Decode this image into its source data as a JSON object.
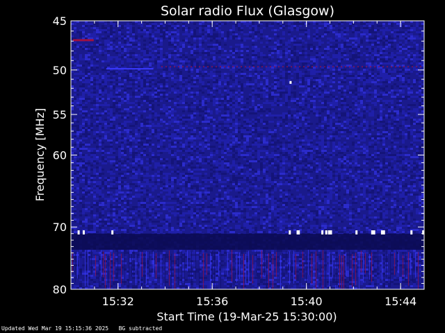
{
  "chart_data": {
    "type": "heatmap",
    "title": "Solar radio Flux (Glasgow)",
    "xlabel": "Start Time (19-Mar-25 15:30:00)",
    "ylabel": "Frequency [MHz]",
    "x_unit": "time",
    "xlim": [
      "15:30:00",
      "15:45:00"
    ],
    "ylim": [
      45,
      80
    ],
    "y_scale": "log",
    "x_ticks": [
      "15:32",
      "15:36",
      "15:40",
      "15:44"
    ],
    "y_ticks": [
      45,
      50,
      55,
      60,
      70,
      80
    ],
    "grid": false,
    "colormap": [
      "#10106a",
      "#2424c0",
      "#3a3aff",
      "#a01040",
      "#ffffff"
    ],
    "background_color": "#1a1a8c",
    "features": {
      "persistent_band_mhz": [
        71,
        73.5
      ],
      "persistent_line_mhz": 49.6,
      "vertical_striations_mhz": [
        73.5,
        80
      ],
      "bright_spot": {
        "time": "15:39:17",
        "freq_mhz": 51.2
      }
    }
  },
  "footer": {
    "updated": "Updated Wed Mar 19 15:15:36 2025",
    "note": "BG subtracted"
  }
}
